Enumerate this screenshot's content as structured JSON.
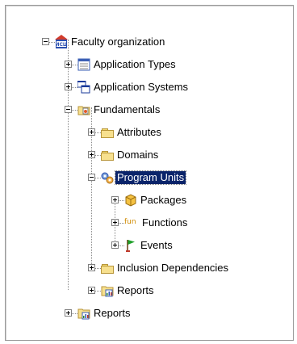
{
  "tree": {
    "root": {
      "label": "Faculty organization",
      "icon": "organization-logo-icon",
      "logo_text": "ИСЦ"
    },
    "items": [
      {
        "key": "application_types",
        "label": "Application Types",
        "icon": "table-window-icon"
      },
      {
        "key": "application_systems",
        "label": "Application Systems",
        "icon": "multiple-windows-icon"
      },
      {
        "key": "fundamentals",
        "label": "Fundamentals",
        "icon": "folder-doc-icon"
      },
      {
        "key": "attributes",
        "label": "Attributes",
        "icon": "folder-icon"
      },
      {
        "key": "domains",
        "label": "Domains",
        "icon": "folder-icon"
      },
      {
        "key": "program_units",
        "label": "Program Units",
        "icon": "gears-icon",
        "selected": true
      },
      {
        "key": "packages",
        "label": "Packages",
        "icon": "package-icon"
      },
      {
        "key": "functions",
        "label": "Functions",
        "icon": "fun-icon",
        "icon_text": "fun"
      },
      {
        "key": "events",
        "label": "Events",
        "icon": "flag-icon"
      },
      {
        "key": "inclusion_dependencies",
        "label": "Inclusion Dependencies",
        "icon": "folder-icon"
      },
      {
        "key": "reports_inner",
        "label": "Reports",
        "icon": "reports-icon"
      },
      {
        "key": "reports_outer",
        "label": "Reports",
        "icon": "reports-icon"
      }
    ]
  },
  "colors": {
    "selection": "#0a246a",
    "fun_text": "#d08a00"
  }
}
